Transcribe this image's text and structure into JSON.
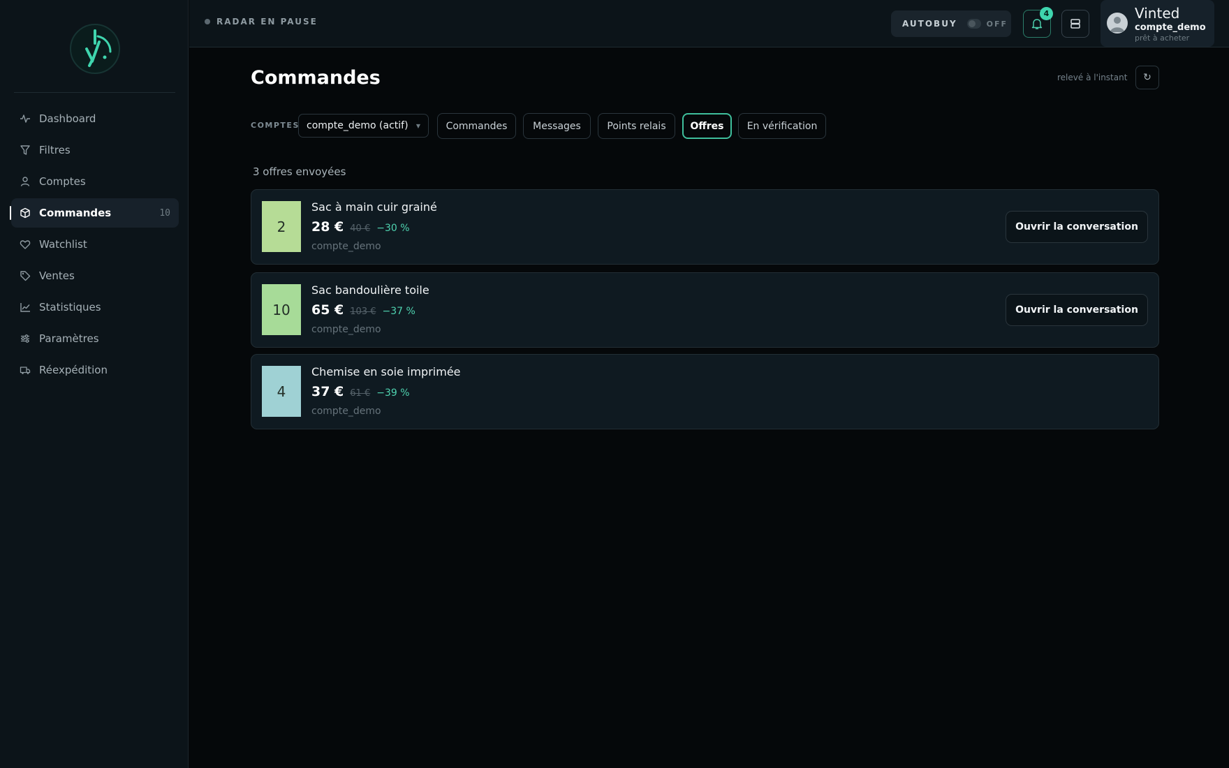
{
  "sidebar": {
    "items": [
      {
        "label": "Dashboard",
        "icon": "activity-icon"
      },
      {
        "label": "Filtres",
        "icon": "filter-icon"
      },
      {
        "label": "Comptes",
        "icon": "user-icon"
      },
      {
        "label": "Commandes",
        "icon": "box-icon",
        "count": "10",
        "active": true
      },
      {
        "label": "Watchlist",
        "icon": "heart-icon"
      },
      {
        "label": "Ventes",
        "icon": "tag-icon"
      },
      {
        "label": "Statistiques",
        "icon": "chart-icon"
      },
      {
        "label": "Paramètres",
        "icon": "sliders-icon"
      },
      {
        "label": "Réexpédition",
        "icon": "truck-icon"
      }
    ]
  },
  "topbar": {
    "radar_status": "RADAR EN PAUSE",
    "autobuy_label": "AUTOBUY",
    "autobuy_state": "OFF",
    "notifications_count": "4",
    "account": {
      "platform": "Vinted",
      "username": "compte_demo",
      "status": "prêt à acheter"
    }
  },
  "main": {
    "title": "Commandes",
    "refresh_label": "relevé à l'instant",
    "refresh_icon": "↻",
    "accounts_label": "COMPTES",
    "account_select": "compte_demo (actif)",
    "tabs": [
      {
        "label": "Commandes"
      },
      {
        "label": "Messages"
      },
      {
        "label": "Points relais"
      },
      {
        "label": "Offres",
        "active": true
      },
      {
        "label": "En vérification"
      }
    ],
    "count_line": "3 offres envoyées",
    "offers": [
      {
        "thumb": "2",
        "title": "Sac à main cuir grainé",
        "price": "28 €",
        "old_price": "40 €",
        "discount": "−30 %",
        "account": "compte_demo",
        "button": "Ouvrir la conversation",
        "color": "#b6dc96"
      },
      {
        "thumb": "10",
        "title": "Sac bandoulière toile",
        "price": "65 €",
        "old_price": "103 €",
        "discount": "−37 %",
        "account": "compte_demo",
        "button": "Ouvrir la conversation",
        "color": "#a7db98"
      },
      {
        "thumb": "4",
        "title": "Chemise en soie imprimée",
        "price": "37 €",
        "old_price": "61 €",
        "discount": "−39 %",
        "account": "compte_demo",
        "color": "#9fd1d4"
      }
    ]
  },
  "colors": {
    "accent": "#3fd5ae",
    "background": "#05080a",
    "sidebar": "#0c1419"
  }
}
